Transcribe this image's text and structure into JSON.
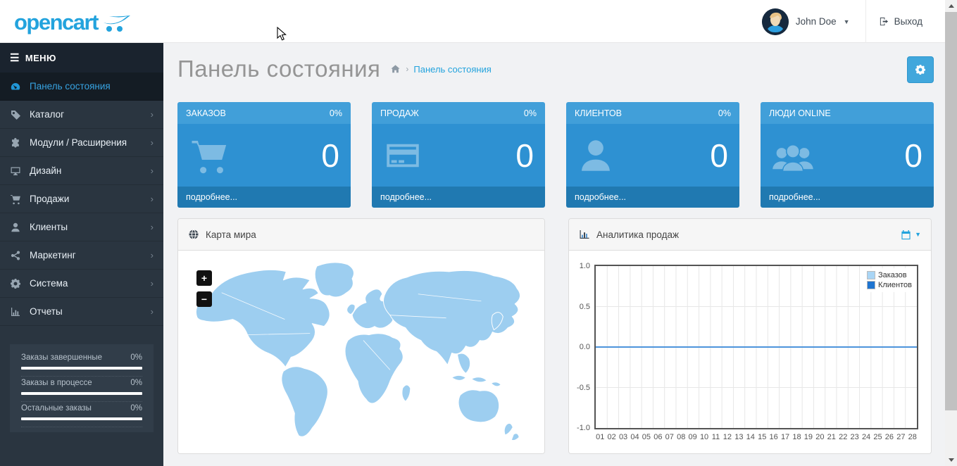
{
  "brand": {
    "logo_text": "opencart",
    "accent_color": "#23a3dd"
  },
  "header": {
    "user_name": "John Doe",
    "logout_label": "Выход"
  },
  "sidebar": {
    "menu_label": "МЕНЮ",
    "items": [
      {
        "label": "Панель состояния",
        "icon": "dashboard-icon",
        "active": true
      },
      {
        "label": "Каталог",
        "icon": "tag-icon"
      },
      {
        "label": "Модули / Расширения",
        "icon": "puzzle-icon"
      },
      {
        "label": "Дизайн",
        "icon": "desktop-icon"
      },
      {
        "label": "Продажи",
        "icon": "cart-icon"
      },
      {
        "label": "Клиенты",
        "icon": "user-icon"
      },
      {
        "label": "Маркетинг",
        "icon": "share-icon"
      },
      {
        "label": "Система",
        "icon": "gear-icon"
      },
      {
        "label": "Отчеты",
        "icon": "bar-chart-icon"
      }
    ],
    "chevron": "›",
    "stats": [
      {
        "label": "Заказы завершенные",
        "value": "0%"
      },
      {
        "label": "Заказы в процессе",
        "value": "0%"
      },
      {
        "label": "Остальные заказы",
        "value": "0%"
      }
    ]
  },
  "page": {
    "title": "Панель состояния",
    "breadcrumb_sep": "›",
    "breadcrumb_current": "Панель состояния"
  },
  "tiles": [
    {
      "label": "ЗАКАЗОВ",
      "percent": "0%",
      "value": "0",
      "link": "подробнее...",
      "icon": "cart-icon"
    },
    {
      "label": "ПРОДАЖ",
      "percent": "0%",
      "value": "0",
      "link": "подробнее...",
      "icon": "credit-card-icon"
    },
    {
      "label": "КЛИЕНТОВ",
      "percent": "0%",
      "value": "0",
      "link": "подробнее...",
      "icon": "user-icon"
    },
    {
      "label": "ЛЮДИ ONLINE",
      "percent": "",
      "value": "0",
      "link": "подробнее...",
      "icon": "users-icon"
    }
  ],
  "panels": {
    "map": {
      "title": "Карта мира",
      "zoom_in": "+",
      "zoom_out": "−",
      "land_color": "#9dcef0"
    },
    "analytics": {
      "title": "Аналитика продаж"
    }
  },
  "chart_data": {
    "type": "line",
    "title": "Аналитика продаж",
    "xlabel": "",
    "ylabel": "",
    "x_tick_labels": [
      "01",
      "02",
      "03",
      "04",
      "05",
      "06",
      "07",
      "08",
      "09",
      "10",
      "11",
      "12",
      "13",
      "14",
      "15",
      "16",
      "17",
      "18",
      "19",
      "20",
      "21",
      "22",
      "23",
      "24",
      "25",
      "26",
      "27",
      "28"
    ],
    "y_tick_labels": [
      "1.0",
      "0.5",
      "0.0",
      "-0.5",
      "-1.0"
    ],
    "y_ticks": [
      1.0,
      0.5,
      0.0,
      -0.5,
      -1.0
    ],
    "ylim": [
      -1.0,
      1.0
    ],
    "grid": true,
    "gridline_color": "#e7e7e7",
    "plot_border_color": "#545454",
    "legend_position": "top-right",
    "visible_line_color": "#4d94db",
    "series": [
      {
        "name": "Заказов",
        "color": "#a9d5f5",
        "values": [
          0,
          0,
          0,
          0,
          0,
          0,
          0,
          0,
          0,
          0,
          0,
          0,
          0,
          0,
          0,
          0,
          0,
          0,
          0,
          0,
          0,
          0,
          0,
          0,
          0,
          0,
          0,
          0
        ]
      },
      {
        "name": "Клиентов",
        "color": "#1e74d0",
        "values": [
          0,
          0,
          0,
          0,
          0,
          0,
          0,
          0,
          0,
          0,
          0,
          0,
          0,
          0,
          0,
          0,
          0,
          0,
          0,
          0,
          0,
          0,
          0,
          0,
          0,
          0,
          0,
          0
        ]
      }
    ]
  }
}
